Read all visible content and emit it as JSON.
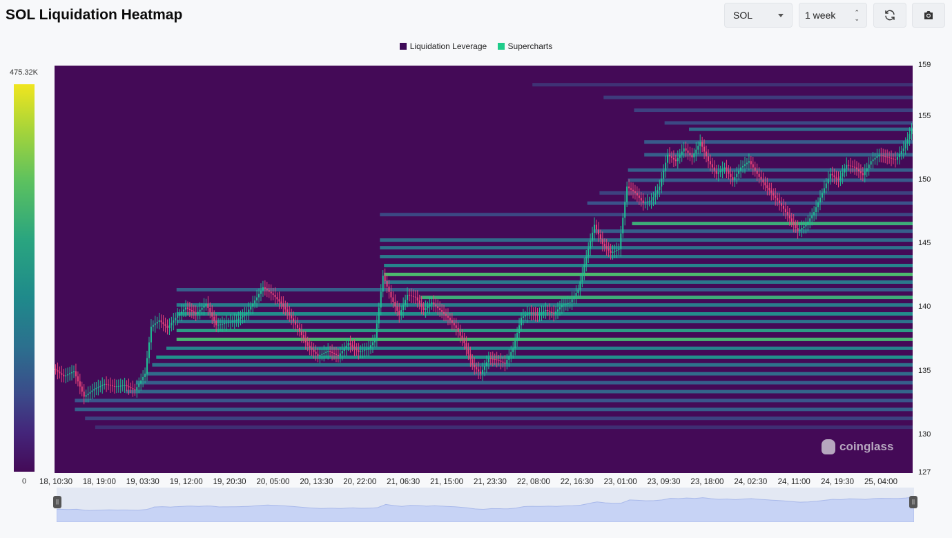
{
  "header": {
    "title": "SOL Liquidation Heatmap",
    "coin_select": "SOL",
    "range_select": "1 week",
    "refresh_icon": "refresh-icon",
    "screenshot_icon": "camera-icon"
  },
  "colorbar": {
    "max_label": "475.32K",
    "min_label": "0"
  },
  "watermark": "coinglass",
  "colors": {
    "background": "#440a57",
    "up_candle": "#1fbf94",
    "down_candle": "#e8447a",
    "navigator": "#c7d3f5"
  },
  "chart_data": {
    "type": "heatmap",
    "title": "SOL Liquidation Heatmap",
    "legend": [
      {
        "name": "Liquidation Leverage",
        "color": "#3d0a57"
      },
      {
        "name": "Supercharts",
        "color": "#1fcc8a"
      }
    ],
    "x_ticks": [
      "18, 10:30",
      "18, 19:00",
      "19, 03:30",
      "19, 12:00",
      "19, 20:30",
      "20, 05:00",
      "20, 13:30",
      "20, 22:00",
      "21, 06:30",
      "21, 15:00",
      "21, 23:30",
      "22, 08:00",
      "22, 16:30",
      "23, 01:00",
      "23, 09:30",
      "23, 18:00",
      "24, 02:30",
      "24, 11:00",
      "24, 19:30",
      "25, 04:00"
    ],
    "y_ticks": [
      127,
      130,
      135,
      140,
      145,
      150,
      155,
      159
    ],
    "ylim": [
      127,
      159
    ],
    "colorbar_range": [
      0,
      475320
    ],
    "price_path": [
      [
        0,
        135.2
      ],
      [
        5,
        134.6
      ],
      [
        10,
        135.0
      ],
      [
        15,
        133.0
      ],
      [
        20,
        133.6
      ],
      [
        25,
        134.0
      ],
      [
        30,
        133.8
      ],
      [
        35,
        133.9
      ],
      [
        40,
        133.5
      ],
      [
        45,
        134.8
      ],
      [
        48,
        138.5
      ],
      [
        52,
        139.0
      ],
      [
        56,
        138.4
      ],
      [
        60,
        139.2
      ],
      [
        65,
        140.0
      ],
      [
        70,
        139.5
      ],
      [
        75,
        140.3
      ],
      [
        80,
        138.6
      ],
      [
        85,
        138.8
      ],
      [
        90,
        139.0
      ],
      [
        95,
        139.6
      ],
      [
        100,
        140.8
      ],
      [
        103,
        141.6
      ],
      [
        108,
        141.0
      ],
      [
        112,
        140.3
      ],
      [
        116,
        139.4
      ],
      [
        120,
        138.4
      ],
      [
        125,
        137.0
      ],
      [
        130,
        136.2
      ],
      [
        135,
        136.6
      ],
      [
        140,
        136.2
      ],
      [
        145,
        137.2
      ],
      [
        150,
        136.5
      ],
      [
        155,
        136.8
      ],
      [
        158,
        137.5
      ],
      [
        162,
        142.5
      ],
      [
        166,
        140.8
      ],
      [
        170,
        139.4
      ],
      [
        174,
        141.0
      ],
      [
        178,
        140.8
      ],
      [
        182,
        139.8
      ],
      [
        186,
        140.4
      ],
      [
        190,
        139.8
      ],
      [
        194,
        139.2
      ],
      [
        198,
        138.4
      ],
      [
        202,
        137.2
      ],
      [
        206,
        135.5
      ],
      [
        210,
        134.8
      ],
      [
        214,
        136.0
      ],
      [
        218,
        135.9
      ],
      [
        222,
        135.6
      ],
      [
        226,
        136.8
      ],
      [
        230,
        139.2
      ],
      [
        234,
        139.6
      ],
      [
        238,
        139.4
      ],
      [
        242,
        139.8
      ],
      [
        246,
        139.5
      ],
      [
        250,
        140.2
      ],
      [
        254,
        140.4
      ],
      [
        258,
        141.4
      ],
      [
        262,
        144.0
      ],
      [
        266,
        146.5
      ],
      [
        270,
        145.0
      ],
      [
        274,
        144.3
      ],
      [
        278,
        144.6
      ],
      [
        282,
        149.5
      ],
      [
        286,
        149.0
      ],
      [
        290,
        148.2
      ],
      [
        294,
        148.4
      ],
      [
        298,
        149.5
      ],
      [
        302,
        152.0
      ],
      [
        306,
        151.5
      ],
      [
        310,
        152.5
      ],
      [
        314,
        151.8
      ],
      [
        318,
        153.0
      ],
      [
        322,
        151.5
      ],
      [
        326,
        150.5
      ],
      [
        330,
        151.0
      ],
      [
        334,
        150.0
      ],
      [
        338,
        151.0
      ],
      [
        342,
        151.5
      ],
      [
        346,
        150.5
      ],
      [
        350,
        149.6
      ],
      [
        354,
        148.8
      ],
      [
        358,
        148.0
      ],
      [
        362,
        147.0
      ],
      [
        366,
        146.0
      ],
      [
        370,
        146.5
      ],
      [
        374,
        147.5
      ],
      [
        378,
        149.0
      ],
      [
        382,
        150.5
      ],
      [
        386,
        150.0
      ],
      [
        390,
        151.2
      ],
      [
        394,
        151.0
      ],
      [
        398,
        150.4
      ],
      [
        402,
        151.5
      ],
      [
        406,
        152.0
      ],
      [
        410,
        151.8
      ],
      [
        414,
        151.6
      ],
      [
        418,
        152.5
      ],
      [
        422,
        154.0
      ]
    ],
    "liquidation_bands": [
      {
        "price": 157.5,
        "from": 235,
        "intensity": 0.15
      },
      {
        "price": 156.5,
        "from": 270,
        "intensity": 0.18
      },
      {
        "price": 155.5,
        "from": 285,
        "intensity": 0.2
      },
      {
        "price": 154.5,
        "from": 300,
        "intensity": 0.22
      },
      {
        "price": 154.0,
        "from": 312,
        "intensity": 0.35
      },
      {
        "price": 153.0,
        "from": 290,
        "intensity": 0.28
      },
      {
        "price": 152.0,
        "from": 290,
        "intensity": 0.3
      },
      {
        "price": 150.8,
        "from": 282,
        "intensity": 0.3
      },
      {
        "price": 150.0,
        "from": 282,
        "intensity": 0.28
      },
      {
        "price": 149.0,
        "from": 268,
        "intensity": 0.2
      },
      {
        "price": 148.2,
        "from": 262,
        "intensity": 0.25
      },
      {
        "price": 147.3,
        "from": 160,
        "intensity": 0.22
      },
      {
        "price": 146.6,
        "from": 284,
        "intensity": 0.62
      },
      {
        "price": 146.0,
        "from": 265,
        "intensity": 0.3
      },
      {
        "price": 145.3,
        "from": 160,
        "intensity": 0.35
      },
      {
        "price": 144.7,
        "from": 160,
        "intensity": 0.38
      },
      {
        "price": 144.0,
        "from": 160,
        "intensity": 0.4
      },
      {
        "price": 143.3,
        "from": 162,
        "intensity": 0.45
      },
      {
        "price": 142.6,
        "from": 162,
        "intensity": 0.68
      },
      {
        "price": 142.0,
        "from": 162,
        "intensity": 0.4
      },
      {
        "price": 141.4,
        "from": 60,
        "intensity": 0.3
      },
      {
        "price": 140.8,
        "from": 180,
        "intensity": 0.62
      },
      {
        "price": 140.2,
        "from": 60,
        "intensity": 0.42
      },
      {
        "price": 139.5,
        "from": 60,
        "intensity": 0.48
      },
      {
        "price": 138.9,
        "from": 60,
        "intensity": 0.38
      },
      {
        "price": 138.2,
        "from": 60,
        "intensity": 0.55
      },
      {
        "price": 137.5,
        "from": 60,
        "intensity": 0.66
      },
      {
        "price": 136.8,
        "from": 55,
        "intensity": 0.45
      },
      {
        "price": 136.1,
        "from": 50,
        "intensity": 0.5
      },
      {
        "price": 135.5,
        "from": 48,
        "intensity": 0.38
      },
      {
        "price": 134.8,
        "from": 45,
        "intensity": 0.35
      },
      {
        "price": 134.1,
        "from": 40,
        "intensity": 0.3
      },
      {
        "price": 133.4,
        "from": 35,
        "intensity": 0.33
      },
      {
        "price": 132.7,
        "from": 10,
        "intensity": 0.26
      },
      {
        "price": 132.0,
        "from": 10,
        "intensity": 0.3
      },
      {
        "price": 131.3,
        "from": 15,
        "intensity": 0.2
      },
      {
        "price": 130.6,
        "from": 20,
        "intensity": 0.14
      }
    ]
  }
}
